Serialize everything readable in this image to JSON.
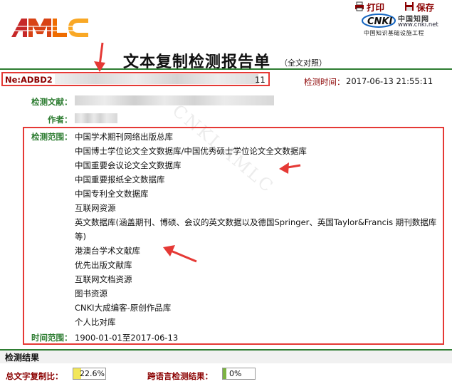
{
  "toolbar": {
    "print_label": "打印",
    "save_label": "保存"
  },
  "logo": {
    "text": "AMLC",
    "icon": "amlc-logo"
  },
  "cnki": {
    "mark": "CNKI",
    "cn_name": "中国知网",
    "url": "www.cnki.net",
    "subtitle": "中国知识基础设施工程"
  },
  "report": {
    "title": "文本复制检测报告单",
    "subtitle": "（全文对照）"
  },
  "header": {
    "ne_label": "Ne:ADBD2",
    "ne_tail": "11",
    "time_label": "检测时间：",
    "time_value": "2017-06-13 21:55:11"
  },
  "fields": {
    "doc_label": "检测文献：",
    "author_label": "作者：",
    "scope_label": "检测范围：",
    "range_label": "时间范围：",
    "range_value": "1900-01-01至2017-06-13"
  },
  "scope_items": [
    "中国学术期刊网络出版总库",
    "中国博士学位论文全文数据库/中国优秀硕士学位论文全文数据库",
    "中国重要会议论文全文数据库",
    "中国重要报纸全文数据库",
    "中国专利全文数据库",
    "互联网资源",
    "英文数据库(涵盖期刊、博硕、会议的英文数据以及德国Springer、英国Taylor&Francis 期刊数据库等)",
    "港澳台学术文献库",
    "优先出版文献库",
    "互联网文档资源",
    "图书资源",
    "CNKI大成编客-原创作品库",
    "个人比对库"
  ],
  "result": {
    "title": "检测结果",
    "total_label": "总文字复制比：",
    "total_value": "22.6%",
    "total_fraction": 0.226,
    "cross_label": "跨语言检测结果：",
    "cross_value": "0%",
    "cross_fraction": 0.0
  },
  "watermark": "CNKI AMLC",
  "colors": {
    "label_green": "#2e7d32",
    "label_red": "#8b0000",
    "highlight_red": "#e53935",
    "bar_yellow": "#f2e65a",
    "bar_green": "#7cb342"
  }
}
